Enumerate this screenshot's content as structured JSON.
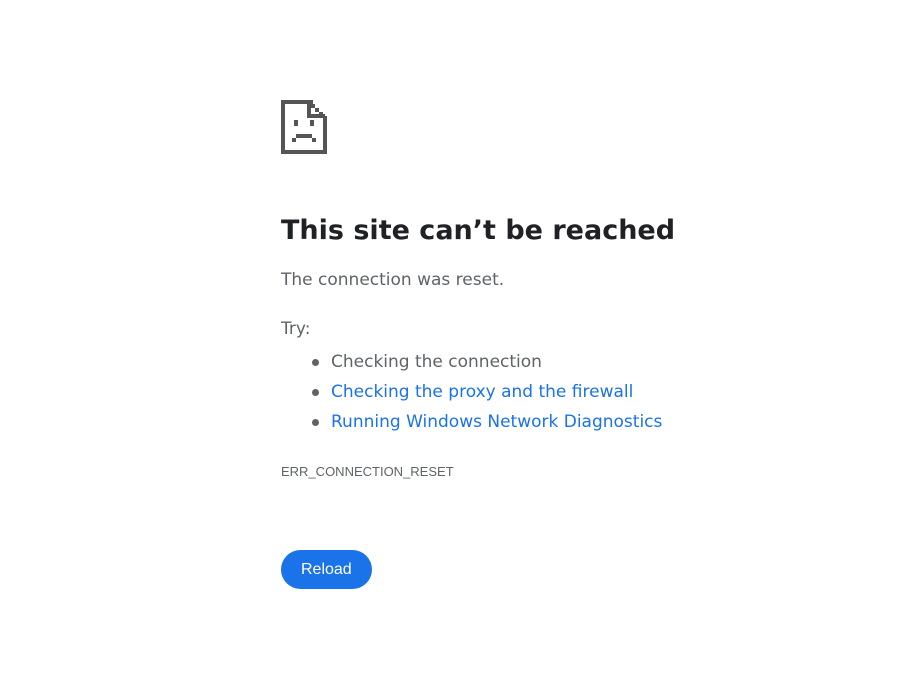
{
  "error": {
    "icon": "sad-page-icon",
    "headline": "This site can’t be reached",
    "summary": "The connection was reset.",
    "try_label": "Try:",
    "suggestions": [
      {
        "label": "Checking the connection",
        "is_link": false
      },
      {
        "label": "Checking the proxy and the firewall",
        "is_link": true
      },
      {
        "label": "Running Windows Network Diagnostics",
        "is_link": true
      }
    ],
    "code": "ERR_CONNECTION_RESET"
  },
  "actions": {
    "reload_label": "Reload"
  },
  "colors": {
    "accent": "#1a73e8",
    "text": "#5f6368",
    "heading": "#202124",
    "icon": "#555555"
  }
}
